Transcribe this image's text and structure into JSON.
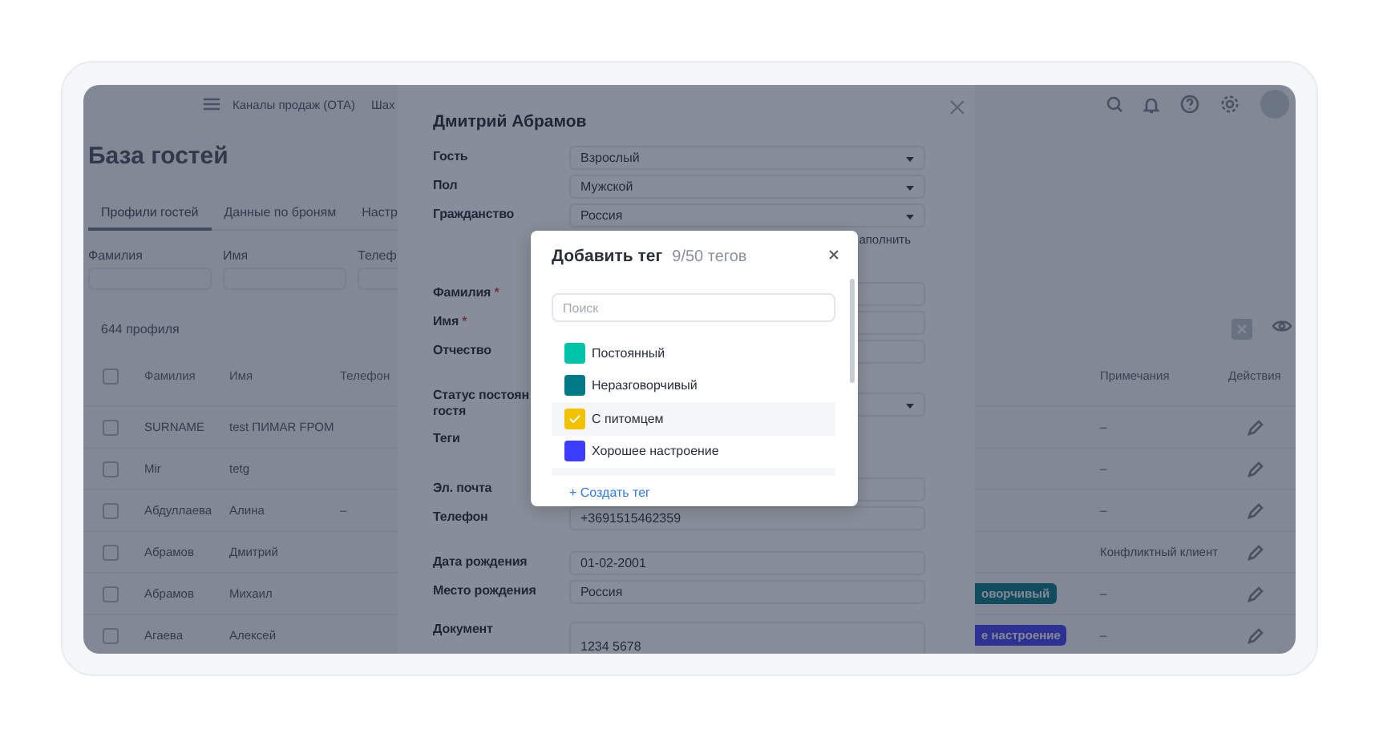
{
  "app": {
    "nav_links": [
      "Каналы продаж (OTA)",
      "Шах"
    ],
    "page_title": "База гостей",
    "tabs": [
      {
        "label": "Профили гостей",
        "selected": true
      },
      {
        "label": "Данные по броням",
        "selected": false
      },
      {
        "label": "Настр",
        "selected": false
      }
    ],
    "filters": [
      {
        "label": "Фамилия"
      },
      {
        "label": "Имя"
      },
      {
        "label": "Телеф"
      }
    ],
    "count": "644 профиля",
    "table": {
      "columns": [
        "Фамилия",
        "Имя",
        "Телефон",
        "Примечания",
        "Действия"
      ],
      "all_checked": false,
      "rows": [
        {
          "checked": false,
          "surname": "SURNAME",
          "name": "test ПИМАR FРОМ",
          "note": "–"
        },
        {
          "checked": false,
          "surname": "Mir",
          "name": "tetg",
          "note": "–"
        },
        {
          "checked": false,
          "surname": "Абдуллаева",
          "name": "Алина",
          "phone": "–",
          "note": "–"
        },
        {
          "checked": false,
          "surname": "Абрамов",
          "name": "Дмитрий",
          "note": "Конфликтный клиент"
        },
        {
          "checked": false,
          "surname": "Абрамов",
          "name": "Михаил",
          "tag": {
            "text": "оворчивый",
            "color": "#114d5e"
          },
          "note": "–"
        },
        {
          "checked": false,
          "surname": "Агаева",
          "name": "Алексей",
          "tag": {
            "text": "е настроение",
            "color": "#2c3293"
          },
          "note": "–"
        }
      ]
    }
  },
  "guest_form": {
    "title": "Дмитрий Абрамов",
    "groups": [
      [
        {
          "kind": "select",
          "label": "Гость",
          "value": "Взрослый"
        },
        {
          "kind": "select",
          "label": "Пол",
          "value": "Мужской"
        },
        {
          "kind": "select",
          "label": "Гражданство",
          "value": "Россия"
        },
        {
          "kind": "hint",
          "text": "аполнить"
        }
      ],
      [
        {
          "kind": "input",
          "label": "Фамилия",
          "required_mark": "*"
        },
        {
          "kind": "input",
          "label": "Имя",
          "required_mark": "*"
        },
        {
          "kind": "input",
          "label": "Отчество"
        }
      ],
      [
        {
          "kind": "select",
          "label": "Статус постоян",
          "label_line_2": "гостя"
        },
        {
          "kind": "tags",
          "label": "Теги"
        }
      ],
      [
        {
          "kind": "input",
          "label": "Эл. почта"
        },
        {
          "kind": "input",
          "label": "Телефон",
          "value": "+3691515462359"
        }
      ],
      [
        {
          "kind": "input",
          "label": "Дата рождения",
          "value": "01-02-2001"
        },
        {
          "kind": "input",
          "label": "Место рождения",
          "value": "Россия"
        }
      ],
      [
        {
          "kind": "textarea",
          "label": "Документ",
          "value": "1234 5678"
        }
      ]
    ]
  },
  "tag_popup": {
    "title": "Добавить тег",
    "counter": "9/50 тегов",
    "search": {
      "placeholder": "Поиск"
    },
    "items": [
      {
        "label": "Постоянный",
        "color": "#00c4a7",
        "selected": false
      },
      {
        "label": "Неразговорчивый",
        "color": "#007a87",
        "selected": false
      },
      {
        "label": "С питомцем",
        "color": "#f2c200",
        "selected": true
      },
      {
        "label": "Хорошее настроение",
        "color": "#3d3dff",
        "selected": false
      }
    ],
    "create_link": "+ Создать тег"
  }
}
